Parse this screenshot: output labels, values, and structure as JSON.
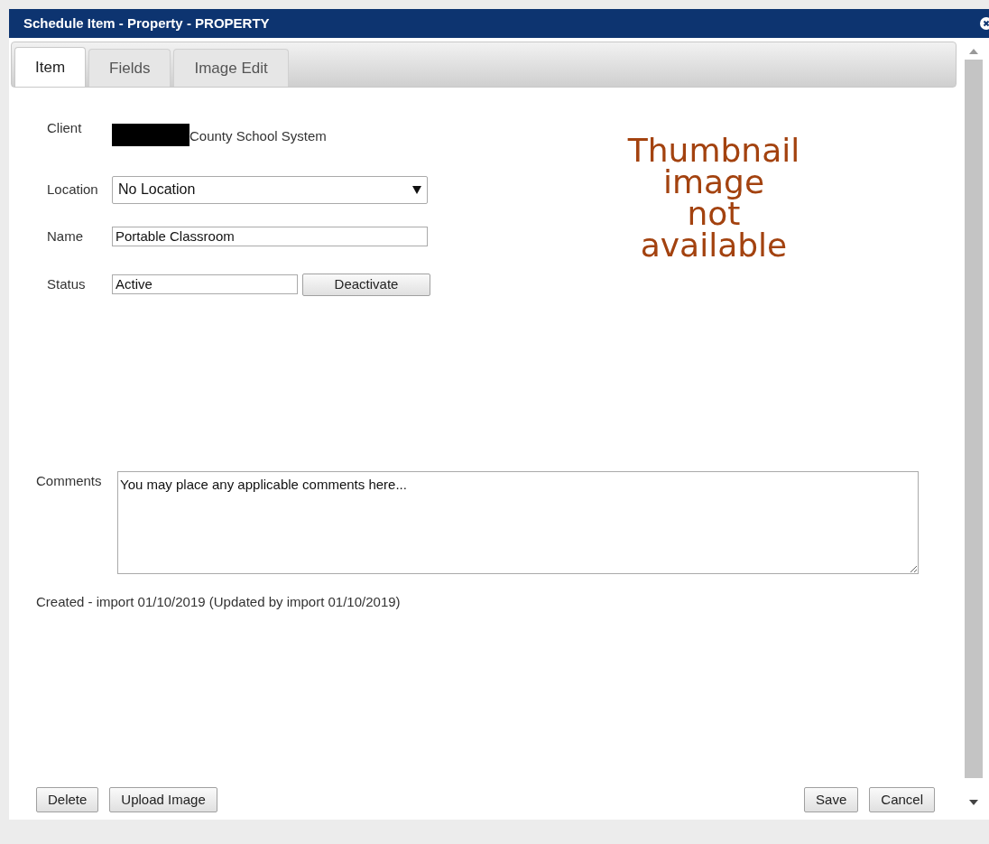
{
  "window": {
    "title": "Schedule Item - Property - PROPERTY"
  },
  "tabs": [
    {
      "label": "Item",
      "selected": true
    },
    {
      "label": "Fields",
      "selected": false
    },
    {
      "label": "Image Edit",
      "selected": false
    }
  ],
  "form": {
    "client": {
      "label": "Client",
      "redacted": true,
      "value": "County School System"
    },
    "location": {
      "label": "Location",
      "value": "No Location"
    },
    "name": {
      "label": "Name",
      "value": "Portable Classroom"
    },
    "status": {
      "label": "Status",
      "value": "Active",
      "action": "Deactivate"
    },
    "comments": {
      "label": "Comments",
      "value": "You may place any applicable comments here..."
    }
  },
  "thumbnail": {
    "lines": [
      "Thumbnail",
      "image",
      "not",
      "available"
    ]
  },
  "audit": "Created - import 01/10/2019 (Updated by import 01/10/2019)",
  "buttons_left": [
    "Delete",
    "Upload Image"
  ],
  "buttons_right": [
    "Save",
    "Cancel"
  ]
}
